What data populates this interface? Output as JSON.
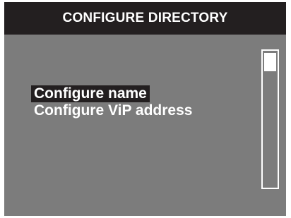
{
  "header": {
    "title": "CONFIGURE DIRECTORY"
  },
  "menu": {
    "items": [
      {
        "label": "Configure name",
        "selected": true
      },
      {
        "label": "Configure ViP address",
        "selected": false
      }
    ]
  },
  "scrollbar": {
    "position_fraction": 0.0
  },
  "colors": {
    "background": "#7c7c7c",
    "title_bar": "#231f20",
    "text": "#ffffff",
    "selection": "#231f20"
  }
}
